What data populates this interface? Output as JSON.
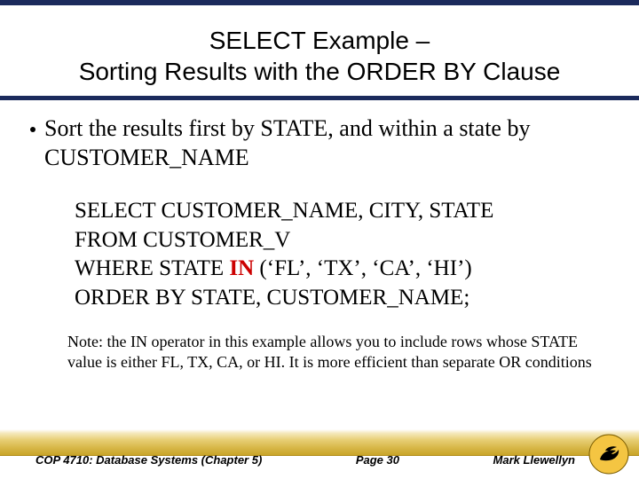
{
  "title": {
    "line1": "SELECT Example –",
    "line2": "Sorting Results with the ORDER BY Clause"
  },
  "bullet": {
    "text": "Sort the results first by STATE, and within a state by CUSTOMER_NAME"
  },
  "sql": {
    "l1_pre": "SELECT CUSTOMER_NAME, CITY, STATE",
    "l2": "FROM CUSTOMER_V",
    "l3_pre": "WHERE STATE ",
    "l3_kw": "IN",
    "l3_post": " (‘FL’, ‘TX’, ‘CA’, ‘HI’)",
    "l4": "ORDER BY STATE, CUSTOMER_NAME;"
  },
  "note": "Note: the IN operator in this example allows you to include rows whose STATE value is either FL, TX, CA, or HI. It is more efficient than separate OR conditions",
  "footer": {
    "left": "COP 4710: Database Systems  (Chapter 5)",
    "center": "Page 30",
    "right": "Mark Llewellyn"
  },
  "logo_alt": "UCF Pegasus seal"
}
